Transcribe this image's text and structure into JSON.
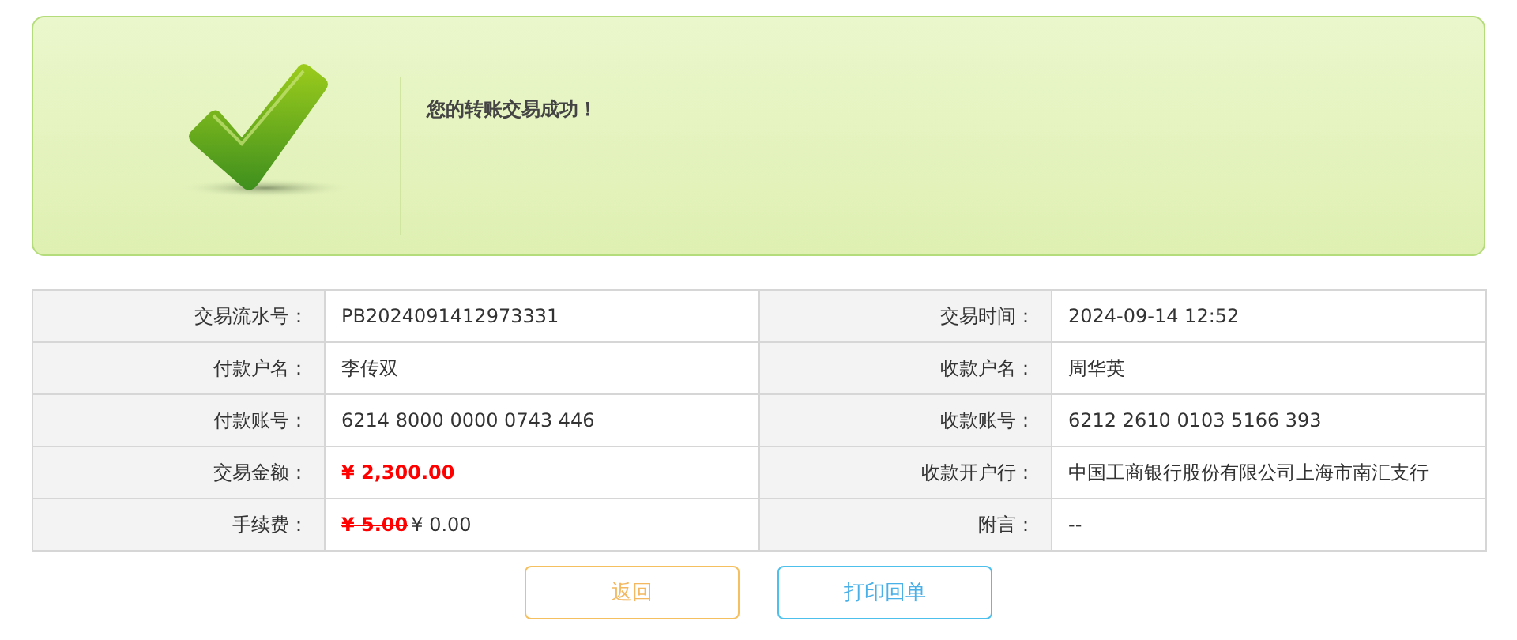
{
  "banner": {
    "message": "您的转账交易成功！"
  },
  "details": [
    {
      "left": {
        "label": "交易流水号：",
        "kind": "text",
        "value": "PB2024091412973331"
      },
      "right": {
        "label": "交易时间：",
        "kind": "text",
        "value": "2024-09-14 12:52"
      }
    },
    {
      "left": {
        "label": "付款户名：",
        "kind": "text",
        "value": "李传双"
      },
      "right": {
        "label": "收款户名：",
        "kind": "text",
        "value": "周华英"
      }
    },
    {
      "left": {
        "label": "付款账号：",
        "kind": "text",
        "value": "6214 8000 0000 0743 446"
      },
      "right": {
        "label": "收款账号：",
        "kind": "text",
        "value": "6212 2610 0103 5166 393"
      }
    },
    {
      "left": {
        "label": "交易金额：",
        "kind": "amount",
        "value": "¥ 2,300.00"
      },
      "right": {
        "label": "收款开户行：",
        "kind": "text",
        "value": "中国工商银行股份有限公司上海市南汇支行"
      }
    },
    {
      "left": {
        "label": "手续费：",
        "kind": "fee",
        "old": "¥ 5.00",
        "value": "¥ 0.00"
      },
      "right": {
        "label": "附言：",
        "kind": "text",
        "value": "--"
      }
    }
  ],
  "buttons": [
    {
      "label": "返回",
      "kind": "back"
    },
    {
      "label": "打印回单",
      "kind": "print"
    }
  ]
}
